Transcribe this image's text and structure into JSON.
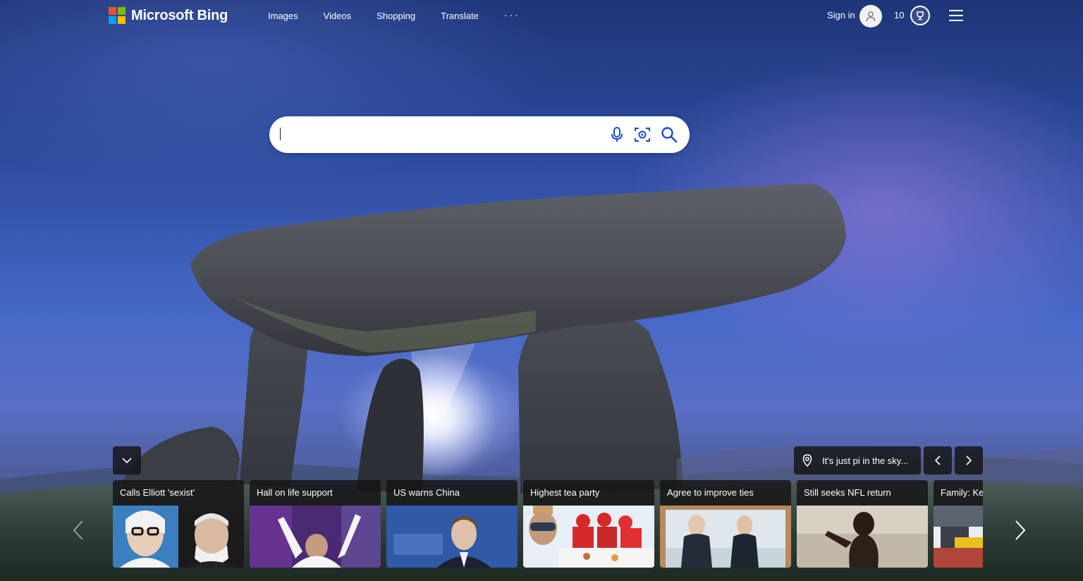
{
  "header": {
    "brand": "Microsoft Bing",
    "nav": [
      "Images",
      "Videos",
      "Shopping",
      "Translate"
    ],
    "more_label": "···",
    "signin_label": "Sign in",
    "points": "10"
  },
  "icons": {
    "logo": "microsoft-logo-icon",
    "avatar": "user-icon",
    "rewards": "rewards-trophy-icon",
    "menu": "hamburger-menu-icon",
    "mic": "microphone-icon",
    "visual_search": "visual-search-icon",
    "search": "search-icon",
    "collapse": "chevron-down-icon",
    "location": "location-pin-icon",
    "prev": "chevron-left-icon",
    "next": "chevron-right-icon"
  },
  "colors": {
    "logo_red": "#f25022",
    "logo_green": "#7fba00",
    "logo_blue": "#00a4ef",
    "logo_yellow": "#ffb900",
    "search_accent": "#174ae4"
  },
  "search": {
    "value": "",
    "placeholder": ""
  },
  "image_caption": "It's just pi in the sky...",
  "news": [
    {
      "title": "Calls Elliott 'sexist'"
    },
    {
      "title": "Hall on life support"
    },
    {
      "title": "US warns China"
    },
    {
      "title": "Highest tea party"
    },
    {
      "title": "Agree to improve ties"
    },
    {
      "title": "Still seeks NFL return"
    },
    {
      "title": "Family: Ke"
    }
  ]
}
